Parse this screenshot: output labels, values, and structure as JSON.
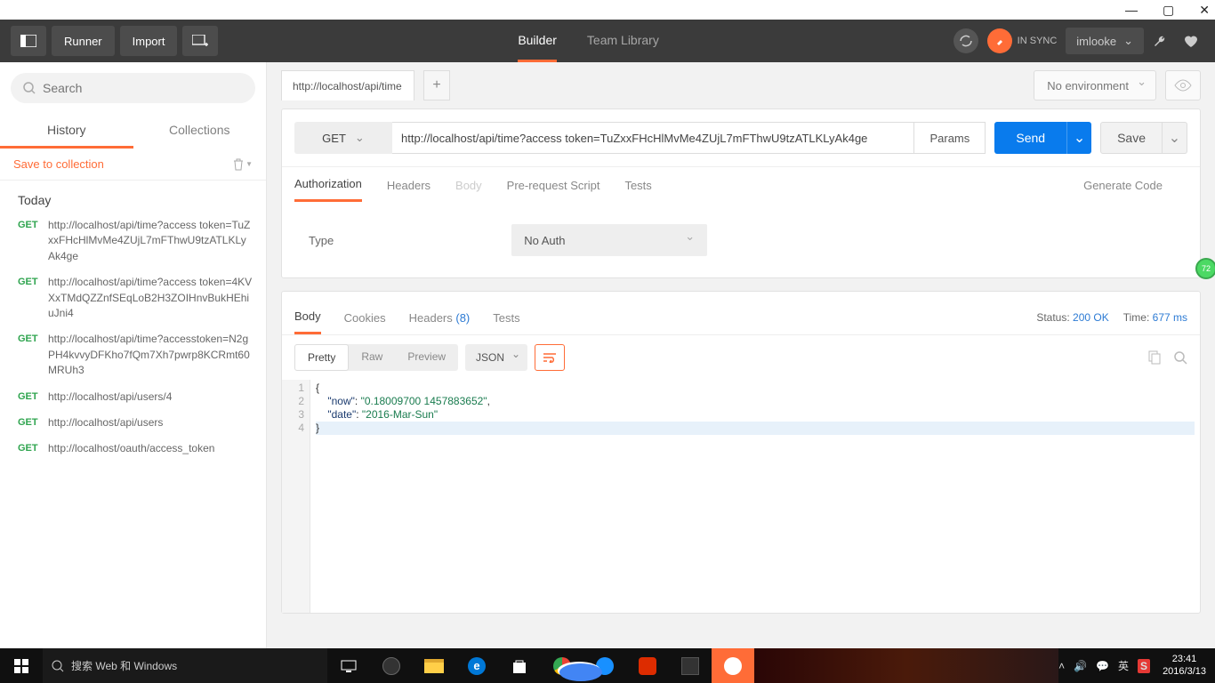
{
  "window_controls": {
    "min": "—",
    "max": "▢",
    "close": "✕"
  },
  "topbar": {
    "runner": "Runner",
    "import": "Import",
    "builder": "Builder",
    "team_library": "Team Library",
    "sync_label": "IN SYNC",
    "username": "imlooke"
  },
  "sidebar": {
    "search_placeholder": "Search",
    "history_tab": "History",
    "collections_tab": "Collections",
    "save_to_collection": "Save to collection",
    "today": "Today",
    "items": [
      {
        "method": "GET",
        "url": "http://localhost/api/time?access token=TuZxxFHcHlMvMe4ZUjL7mFThwU9tzATLKLyAk4ge"
      },
      {
        "method": "GET",
        "url": "http://localhost/api/time?access token=4KVXxTMdQZZnfSEqLoB2H3ZOIHnvBukHEhiuJni4"
      },
      {
        "method": "GET",
        "url": "http://localhost/api/time?accesstoken=N2gPH4kvvyDFKho7fQm7Xh7pwrp8KCRmt60MRUh3"
      },
      {
        "method": "GET",
        "url": "http://localhost/api/users/4"
      },
      {
        "method": "GET",
        "url": "http://localhost/api/users"
      },
      {
        "method": "GET",
        "url": "http://localhost/oauth/access_token"
      }
    ]
  },
  "tabbar": {
    "tab_label": "http://localhost/api/time",
    "env_label": "No environment"
  },
  "request": {
    "method": "GET",
    "url": "http://localhost/api/time?access token=TuZxxFHcHlMvMe4ZUjL7mFThwU9tzATLKLyAk4ge",
    "params": "Params",
    "send": "Send",
    "save": "Save",
    "tabs": {
      "authorization": "Authorization",
      "headers": "Headers",
      "body": "Body",
      "prerequest": "Pre-request Script",
      "tests": "Tests"
    },
    "generate_code": "Generate Code",
    "auth_type_label": "Type",
    "auth_type_value": "No Auth"
  },
  "response": {
    "tabs": {
      "body": "Body",
      "cookies": "Cookies",
      "headers": "Headers",
      "header_count": "(8)",
      "tests": "Tests"
    },
    "status_label": "Status:",
    "status_value": "200 OK",
    "time_label": "Time:",
    "time_value": "677 ms",
    "view": {
      "pretty": "Pretty",
      "raw": "Raw",
      "preview": "Preview"
    },
    "lang": "JSON",
    "lines": [
      "1",
      "2",
      "3",
      "4"
    ],
    "json": {
      "l1": "{",
      "l2_key": "\"now\"",
      "l2_val": "\"0.18009700 1457883652\"",
      "l3_key": "\"date\"",
      "l3_val": "\"2016-Mar-Sun\"",
      "l4": "}"
    }
  },
  "float_badge": "72",
  "taskbar": {
    "search_placeholder": "搜索 Web 和 Windows",
    "ime": "英",
    "clock_time": "23:41",
    "clock_date": "2016/3/13"
  }
}
